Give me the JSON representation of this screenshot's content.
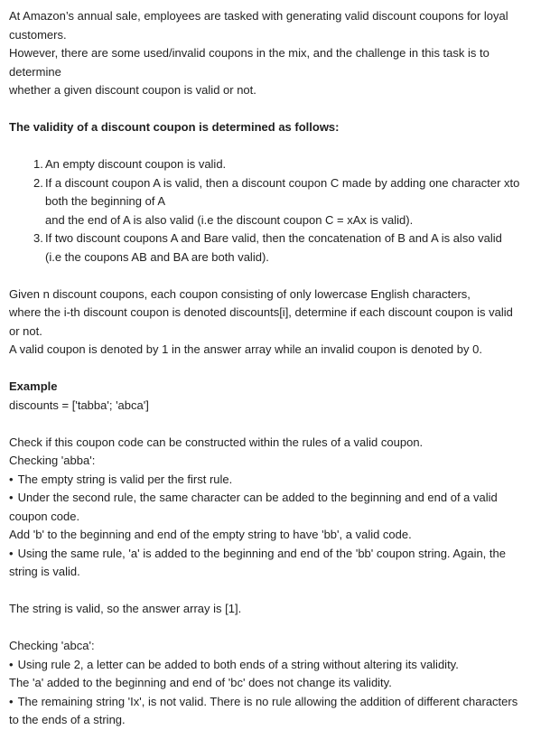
{
  "intro": {
    "p1_l1": "At Amazon’s annual sale, employees are tasked with generating valid discount coupons for loyal",
    "p1_l2": "customers.",
    "p1_l3": "However, there are some used/invalid coupons in the mix, and the challenge in this task is to",
    "p1_l4": "determine",
    "p1_l5": "whether a given discount coupon is valid or not."
  },
  "rules": {
    "heading": "The validity of a discount coupon is determined as follows:",
    "items": [
      {
        "num": "1.",
        "lines": [
          "An empty discount coupon is valid."
        ]
      },
      {
        "num": "2.",
        "lines": [
          "If a discount coupon A is valid, then a discount coupon C made by adding one character xto",
          "both the beginning of A",
          "and the end of A is also valid (i.e the discount coupon C = xAx is valid)."
        ]
      },
      {
        "num": "3.",
        "lines": [
          "If two discount coupons A and Bare valid, then the concatenation of B and A is also valid",
          "(i.e the coupons AB and BA are both valid)."
        ]
      }
    ]
  },
  "task": {
    "l1": "Given n discount coupons, each coupon consisting of only lowercase English characters,",
    "l2": "where the i-th discount coupon is denoted discounts[i], determine if each discount coupon is valid",
    "l3": "or not.",
    "l4": "A valid coupon is denoted by 1 in the answer array while an invalid coupon is denoted by 0."
  },
  "example": {
    "heading": "Example",
    "discounts": "discounts = ['tabba'; 'abca']",
    "check_intro": "Check if this coupon code can be constructed within the rules of a valid coupon.",
    "checking_abba": "Checking 'abba':",
    "b1": "The empty string is valid per the first rule.",
    "b2_l1": "Under the second rule, the same character can be added to the beginning and end of a valid",
    "b2_l2": "coupon code.",
    "add_b": "Add 'b' to the beginning and end of the empty string to have 'bb', a valid code.",
    "b3_l1": "Using the same rule, 'a' is added to the beginning and end of the 'bb' coupon string. Again, the",
    "b3_l2": "string is valid.",
    "result1": "The string is valid, so the answer array is [1].",
    "checking_abca": "Checking 'abca':",
    "c1": "Using rule 2, a letter can be added to both ends of a string without altering its validity.",
    "c2": "The 'a' added to the beginning and end of 'bc' does not change its validity.",
    "c3_l1": "The remaining string 'Ix', is not valid. There is no rule allowing the addition of different characters",
    "c3_l2": "to the ends of a string."
  }
}
